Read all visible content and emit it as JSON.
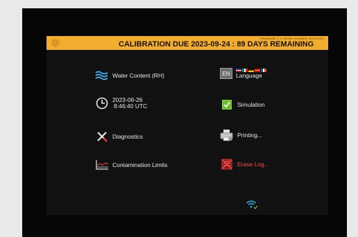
{
  "banner": {
    "firmware": "FIRMWARE X.X SERIAL NUMBER XXXXXXXX",
    "calibration": "CALIBRATION DUE 2023-09-24 : 89 DAYS REMAINING",
    "color": "#f3ad2e"
  },
  "menu": {
    "water_content": "Water Content (RH)",
    "date": "2023-06-26",
    "time": "8:46:40 UTC",
    "diagnostics": "Diagnostics",
    "contamination_limits": "Contamination Limits",
    "language_code": "EN",
    "language": "Language",
    "simulation": "Simulation",
    "printing": "Printing...",
    "erase_log": "Erase Log..."
  },
  "colors": {
    "accent_check": "#6dbb2f",
    "danger": "#ff4a4a"
  },
  "icons": [
    "gear-icon",
    "water-icon",
    "clock-icon",
    "tools-icon",
    "chart-icon",
    "flags-icon",
    "checkbox-icon",
    "printer-icon",
    "erase-icon",
    "brightness-icon",
    "wifi-icon",
    "home-icon"
  ]
}
